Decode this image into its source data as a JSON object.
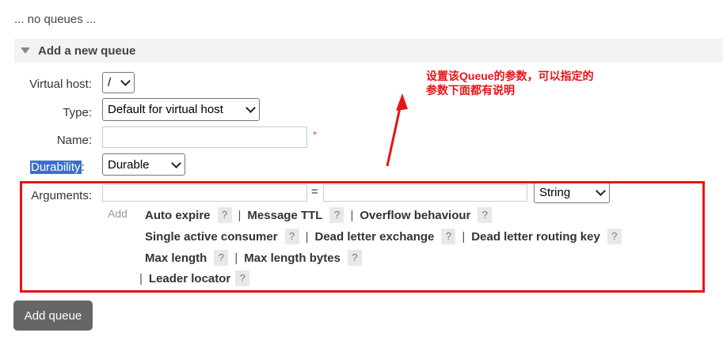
{
  "status": {
    "no_queues": "... no queues ..."
  },
  "section": {
    "title": "Add a new queue"
  },
  "form": {
    "virtual_host": {
      "label": "Virtual host:",
      "value": "/"
    },
    "type": {
      "label": "Type:",
      "value": "Default for virtual host"
    },
    "name": {
      "label": "Name:",
      "value": "",
      "required_mark": "*"
    },
    "durability": {
      "label": "Durability",
      "colon": ":",
      "value": "Durable"
    },
    "arguments": {
      "label": "Arguments:",
      "key_value": "",
      "equals": "=",
      "value_value": "",
      "value_type": "String",
      "add_label": "Add",
      "help_mark": "?",
      "separator": "|",
      "options": [
        "Auto expire",
        "Message TTL",
        "Overflow behaviour",
        "Single active consumer",
        "Dead letter exchange",
        "Dead letter routing key",
        "Max length",
        "Max length bytes",
        "Leader locator"
      ]
    },
    "submit_label": "Add queue"
  },
  "annotation": {
    "text": "设置该Queue的参数，可以指定的参数下面都有说明",
    "color": "#e51515"
  }
}
